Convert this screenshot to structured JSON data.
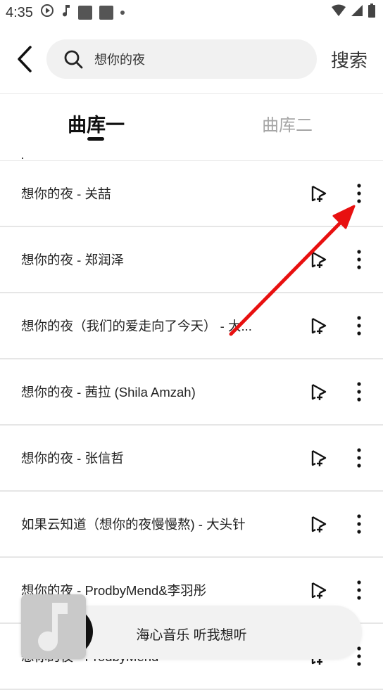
{
  "status": {
    "time": "4:35"
  },
  "search": {
    "query": "想你的夜",
    "button": "搜索"
  },
  "tabs": [
    "曲库一",
    "曲库二"
  ],
  "songs": [
    "想你的夜 - 关喆",
    "想你的夜 - 郑润泽",
    "想你的夜（我们的爱走向了今天） - 大...",
    "想你的夜 - 茜拉 (Shila Amzah)",
    "想你的夜 - 张信哲",
    "如果云知道（想你的夜慢慢熬) - 大头针",
    "想你的夜 - ProdbyMend&李羽彤",
    "想你的夜 - ProdbyMend"
  ],
  "player": {
    "text": "海心音乐 听我想听"
  },
  "colors": {
    "arrow": "#e81010",
    "tab_inactive": "#a5a5a5"
  }
}
